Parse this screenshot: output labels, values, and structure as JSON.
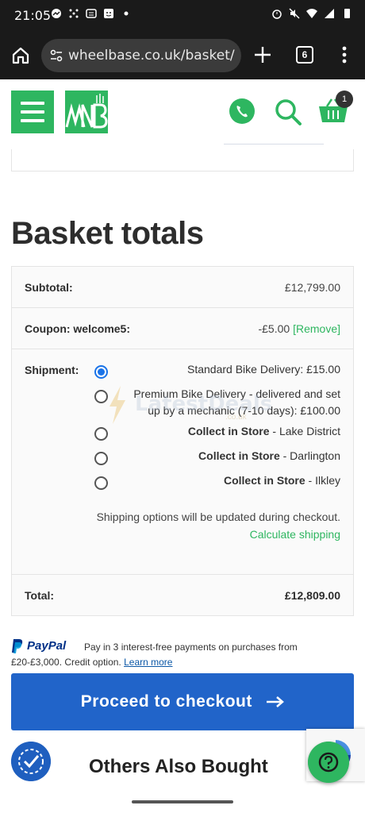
{
  "status_bar": {
    "time": "21:05"
  },
  "browser": {
    "url": "wheelbase.co.uk/basket/",
    "tab_count": "6"
  },
  "header": {
    "basket_count": "1"
  },
  "page": {
    "title": "Basket totals"
  },
  "totals": {
    "subtotal_label": "Subtotal:",
    "subtotal_value": "£12,799.00",
    "coupon_label": "Coupon: welcome5:",
    "coupon_value": "-£5.00",
    "coupon_remove": "[Remove]",
    "shipment_label": "Shipment:",
    "shipping_options": [
      {
        "line1": "Standard Bike Delivery: £15.00",
        "line2": "",
        "bold": "",
        "rest": "",
        "selected": true
      },
      {
        "line1": "Premium Bike Delivery - delivered and set",
        "line2": "up by a mechanic (7-10 days): £100.00",
        "bold": "",
        "rest": "",
        "selected": false
      },
      {
        "line1": "",
        "line2": "",
        "bold": "Collect in Store",
        "rest": " - Lake District",
        "selected": false
      },
      {
        "line1": "",
        "line2": "",
        "bold": "Collect in Store",
        "rest": " - Darlington",
        "selected": false
      },
      {
        "line1": "",
        "line2": "",
        "bold": "Collect in Store",
        "rest": " - Ilkley",
        "selected": false
      }
    ],
    "shipping_note": "Shipping options will be updated during checkout.",
    "calculate_shipping": "Calculate shipping",
    "total_label": "Total:",
    "total_value": "£12,809.00"
  },
  "watermark": {
    "text": "LatestDeals",
    "sub": ".co.uk"
  },
  "paypal": {
    "brand": "PayPal",
    "line1": "Pay in 3 interest-free payments on purchases from",
    "line2": "£20-£3,000. Credit option. ",
    "learn_more": "Learn more"
  },
  "checkout": {
    "label": "Proceed to checkout"
  },
  "others": {
    "title": "Others Also Bought"
  },
  "colors": {
    "brand_green": "#2eb660",
    "checkout_blue": "#2164c9",
    "radio_blue": "#1a73e8"
  }
}
